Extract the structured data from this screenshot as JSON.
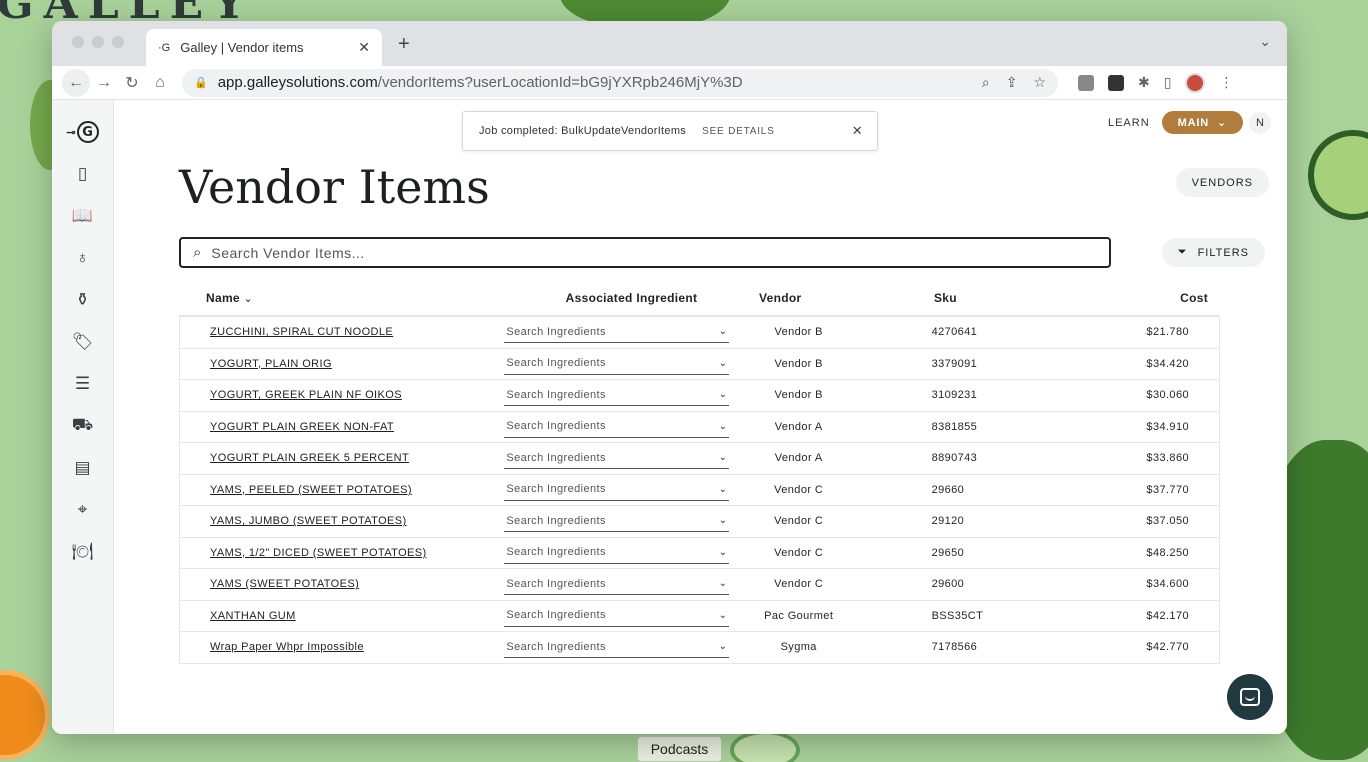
{
  "background": {
    "logo_text": "GALLEY",
    "podcasts_label": "Podcasts"
  },
  "browser": {
    "tab_title": "Galley | Vendor items",
    "tab_favicon": "·G",
    "new_tab": "+",
    "url_domain": "app.galleysolutions.com",
    "url_path": "/vendorItems?userLocationId=bG9jYXRpb246MjY%3D"
  },
  "app": {
    "toast": {
      "message": "Job completed: BulkUpdateVendorItems",
      "link": "SEE DETAILS"
    },
    "header": {
      "learn": "LEARN",
      "main_button": "MAIN",
      "user_initial": "N"
    },
    "page_title": "Vendor Items",
    "vendors_button": "VENDORS",
    "search": {
      "placeholder": "Search Vendor Items..."
    },
    "filters_button": "FILTERS",
    "table": {
      "columns": {
        "name": "Name",
        "ingredient": "Associated Ingredient",
        "vendor": "Vendor",
        "sku": "Sku",
        "cost": "Cost"
      },
      "ingredient_placeholder": "Search Ingredients",
      "rows": [
        {
          "name": "ZUCCHINI, SPIRAL CUT NOODLE",
          "vendor": "Vendor B",
          "sku": "4270641",
          "cost": "$21.780"
        },
        {
          "name": "YOGURT, PLAIN ORIG",
          "vendor": "Vendor B",
          "sku": "3379091",
          "cost": "$34.420"
        },
        {
          "name": "YOGURT, GREEK PLAIN NF OIKOS",
          "vendor": "Vendor B",
          "sku": "3109231",
          "cost": "$30.060"
        },
        {
          "name": "YOGURT PLAIN GREEK NON-FAT",
          "vendor": "Vendor A",
          "sku": "8381855",
          "cost": "$34.910"
        },
        {
          "name": "YOGURT PLAIN GREEK 5 PERCENT",
          "vendor": "Vendor A",
          "sku": "8890743",
          "cost": "$33.860"
        },
        {
          "name": "YAMS, PEELED (SWEET POTATOES)",
          "vendor": "Vendor C",
          "sku": "29660",
          "cost": "$37.770"
        },
        {
          "name": "YAMS, JUMBO (SWEET POTATOES)",
          "vendor": "Vendor C",
          "sku": "29120",
          "cost": "$37.050"
        },
        {
          "name": "YAMS, 1/2\" DICED (SWEET POTATOES)",
          "vendor": "Vendor C",
          "sku": "29650",
          "cost": "$48.250"
        },
        {
          "name": "YAMS (SWEET POTATOES)",
          "vendor": "Vendor C",
          "sku": "29600",
          "cost": "$34.600"
        },
        {
          "name": "XANTHAN GUM",
          "vendor": "Pac Gourmet",
          "sku": "BSS35CT",
          "cost": "$42.170"
        },
        {
          "name": "Wrap Paper Whpr Impossible",
          "vendor": "Sygma",
          "sku": "7178566",
          "cost": "$42.770"
        }
      ]
    }
  },
  "colors": {
    "accent_gold": "#b07d3f",
    "chat_button": "#213a40",
    "desktop_bg": "#a9d19a"
  }
}
